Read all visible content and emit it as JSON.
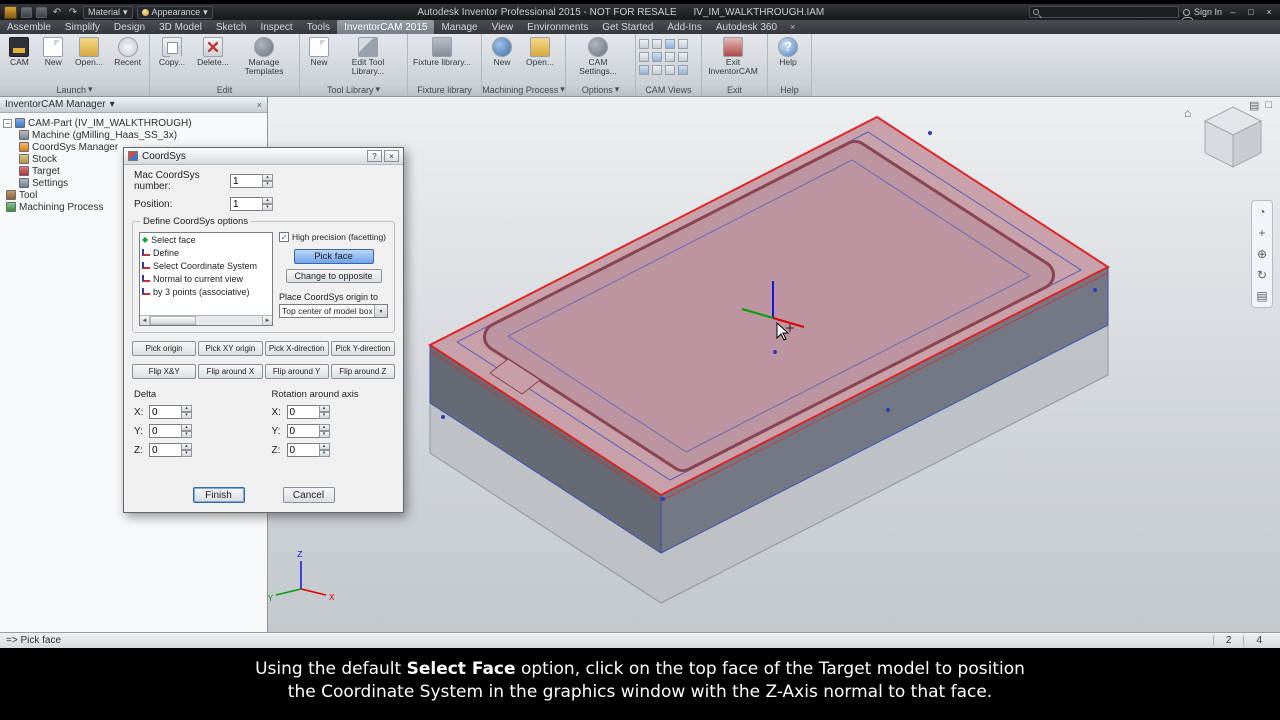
{
  "titlebar": {
    "app_title": "Autodesk Inventor Professional 2015 - NOT FOR RESALE",
    "doc_title": "IV_IM_WALKTHROUGH.IAM",
    "material": "Material",
    "appearance": "Appearance",
    "sign_in": "Sign In"
  },
  "menubar": {
    "tabs": [
      "Assemble",
      "Simplify",
      "Design",
      "3D Model",
      "Sketch",
      "Inspect",
      "Tools",
      "InventorCAM 2015",
      "Manage",
      "View",
      "Environments",
      "Get Started",
      "Add-Ins",
      "Autodesk 360"
    ]
  },
  "ribbon": {
    "launch": {
      "label": "Launch",
      "cam": "CAM",
      "new": "New",
      "open": "Open...",
      "recent": "Recent"
    },
    "edit": {
      "label": "Edit",
      "copy": "Copy...",
      "del": "Delete...",
      "manage": "Manage Templates"
    },
    "tool_library": {
      "label": "Tool Library",
      "new": "New",
      "edit": "Edit Tool Library..."
    },
    "fixture": {
      "label": "Fixture library",
      "btn": "Fixture library..."
    },
    "machining": {
      "label": "Machining Process",
      "new": "New",
      "open": "Open..."
    },
    "options": {
      "label": "Options",
      "settings": "CAM Settings..."
    },
    "cam_views": {
      "label": "CAM Views"
    },
    "exit": {
      "label": "Exit",
      "btn": "Exit InventorCAM"
    },
    "help": {
      "label": "Help",
      "btn": "Help"
    }
  },
  "manager": {
    "title": "InventorCAM Manager",
    "items": [
      {
        "label": "CAM-Part (IV_IM_WALKTHROUGH)"
      },
      {
        "label": "Machine (gMilling_Haas_SS_3x)"
      },
      {
        "label": "CoordSys Manager"
      },
      {
        "label": "Stock"
      },
      {
        "label": "Target"
      },
      {
        "label": "Settings"
      },
      {
        "label": "Tool"
      },
      {
        "label": "Machining Process"
      }
    ]
  },
  "dialog": {
    "title": "CoordSys",
    "mac_label": "Mac CoordSys number:",
    "mac_value": "1",
    "position_label": "Position:",
    "position_value": "1",
    "group_title": "Define CoordSys options",
    "options": [
      "Select face",
      "Define",
      "Select Coordinate System",
      "Normal to current view",
      "by 3 points (associative)"
    ],
    "high_precision": "High precision (facetting)",
    "pick_face": "Pick face",
    "change_opposite": "Change to opposite",
    "place_label": "Place CoordSys origin to",
    "place_value": "Top center of model box",
    "pick_buttons": [
      "Pick origin",
      "Pick XY origin",
      "Pick X-direction",
      "Pick Y-direction"
    ],
    "flip_buttons": [
      "Flip X&Y",
      "Flip around X",
      "Flip around Y",
      "Flip around Z"
    ],
    "delta_label": "Delta",
    "rotation_label": "Rotation around axis",
    "axis_x": "X:",
    "axis_y": "Y:",
    "axis_z": "Z:",
    "delta_x": "0",
    "delta_y": "0",
    "delta_z": "0",
    "rot_x": "0",
    "rot_y": "0",
    "rot_z": "0",
    "finish": "Finish",
    "cancel": "Cancel"
  },
  "viewport": {
    "triad_x": "X",
    "triad_y": "Y",
    "triad_z": "Z"
  },
  "statusbar": {
    "message": "=> Pick face",
    "n1": "2",
    "n2": "4"
  },
  "caption": {
    "line1_pre": "Using the default ",
    "line1_bold": "Select Face",
    "line1_post": " option, click on the top face of the Target model to position",
    "line2": "the Coordinate System in the graphics window with the Z-Axis normal to that face."
  },
  "colors": {
    "selection_pink": "#c89fa9",
    "highlight_red": "#e01f1f",
    "edge_blue": "#3a4db0"
  },
  "icons": {
    "chevron_down": "▾",
    "close": "×",
    "minimize": "–",
    "maximize": "□",
    "help_q": "?",
    "check": "✓",
    "diamond": "◆",
    "left": "◄",
    "right": "►",
    "up": "▴",
    "down": "▾",
    "home": "⌂",
    "wheel": "◔",
    "pan": "+",
    "zoom": "⊕",
    "orbit": "↻",
    "grid": "▤",
    "undo": "↶",
    "redo": "↷",
    "collapse": "−"
  }
}
